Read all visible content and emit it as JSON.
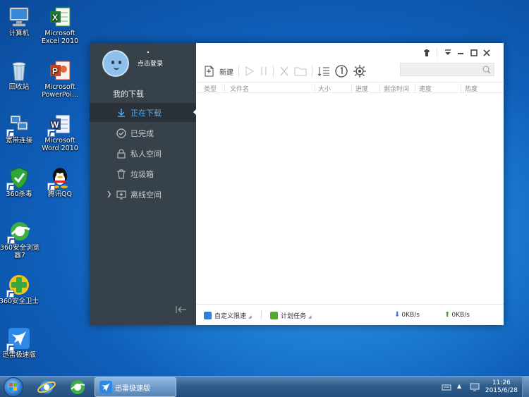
{
  "desktop": {
    "icons": [
      {
        "label": "计算机",
        "icon": "computer-icon"
      },
      {
        "label": "Microsoft Excel 2010",
        "icon": "excel-icon"
      },
      {
        "label": "回收站",
        "icon": "recycle-bin-icon"
      },
      {
        "label": "Microsoft PowerPoi...",
        "icon": "powerpoint-icon"
      },
      {
        "label": "宽带连接",
        "icon": "network-icon"
      },
      {
        "label": "Microsoft Word 2010",
        "icon": "word-icon"
      },
      {
        "label": "360杀毒",
        "icon": "360-antivirus-icon"
      },
      {
        "label": "腾讯QQ",
        "icon": "qq-icon"
      },
      {
        "label": "360安全浏览器7",
        "icon": "360-browser-icon"
      },
      {
        "label": "360安全卫士",
        "icon": "360-guard-icon"
      },
      {
        "label": "迅雷极速版",
        "icon": "thunder-icon"
      }
    ]
  },
  "app": {
    "user": {
      "login_label": "点击登录"
    },
    "sidebar": {
      "section_title": "我的下载",
      "items": [
        {
          "label": "正在下载",
          "icon": "download-arrow-icon",
          "active": true
        },
        {
          "label": "已完成",
          "icon": "check-circle-icon"
        },
        {
          "label": "私人空间",
          "icon": "lock-icon"
        },
        {
          "label": "垃圾箱",
          "icon": "trash-icon"
        },
        {
          "label": "离线空间",
          "icon": "cloud-screen-icon"
        }
      ]
    },
    "toolbar": {
      "new_label": "新建",
      "buttons": [
        "new-file-icon",
        "play-icon",
        "pause-icon",
        "delete-icon",
        "folder-icon",
        "sort-icon",
        "limit-icon",
        "settings-icon"
      ]
    },
    "search": {
      "placeholder": ""
    },
    "columns": [
      "类型",
      "文件名",
      "大小",
      "进度",
      "剩余时间",
      "速度",
      "热度"
    ],
    "status": {
      "speed_limit_label": "自定义限速",
      "schedule_label": "计划任务",
      "download_speed": "0KB/s",
      "upload_speed": "0KB/s"
    }
  },
  "taskbar": {
    "active_task": "迅雷极速版",
    "time": "11:26",
    "date": "2015/6/28"
  },
  "colors": {
    "accent": "#5dacf0",
    "sidebar": "#374149",
    "desktop": "#1f80d6"
  }
}
